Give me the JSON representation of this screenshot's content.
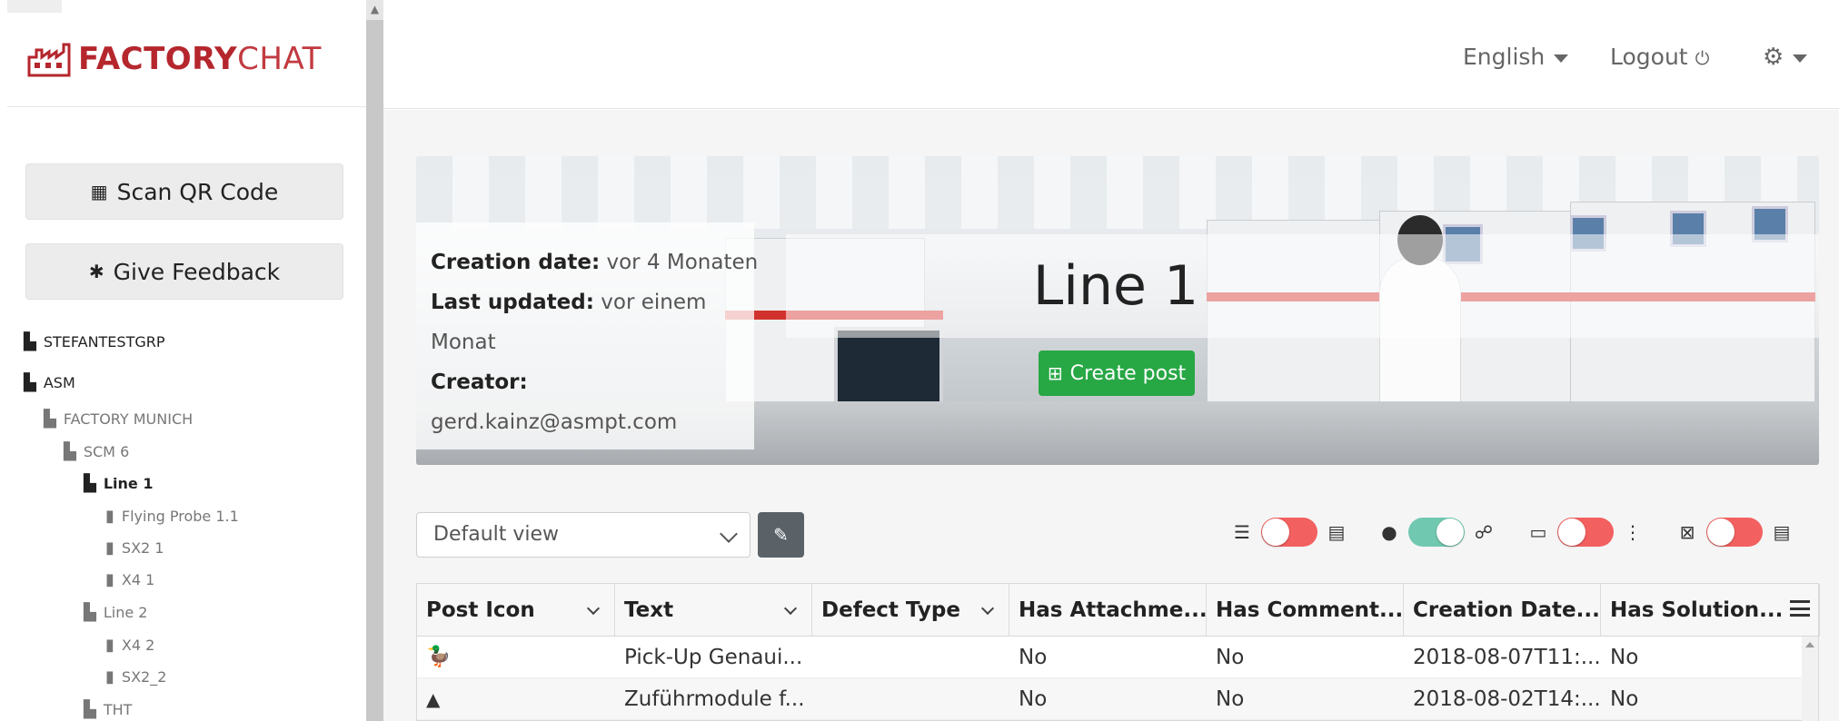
{
  "app": {
    "brand_bold": "FACTORY",
    "brand_light": "CHAT",
    "brand_color": "#b5262d"
  },
  "sidebar": {
    "buttons": [
      {
        "icon": "qr-code-icon",
        "glyph": "▦",
        "label": "Scan QR Code"
      },
      {
        "icon": "bug-icon",
        "glyph": "✱",
        "label": "Give Feedback"
      }
    ],
    "tree": [
      {
        "label": "STEFANTESTGRP",
        "icon": "factory-icon"
      },
      {
        "label": "ASM",
        "icon": "factory-icon"
      },
      {
        "label": "FACTORY MUNICH",
        "icon": "factory-icon"
      },
      {
        "label": "SCM 6",
        "icon": "factory-icon"
      },
      {
        "label": "Line 1",
        "icon": "factory-icon"
      },
      {
        "label": "Flying Probe 1.1",
        "icon": "machine-icon"
      },
      {
        "label": "SX2 1",
        "icon": "machine-icon"
      },
      {
        "label": "X4 1",
        "icon": "machine-icon"
      },
      {
        "label": "Line 2",
        "icon": "factory-icon"
      },
      {
        "label": "X4 2",
        "icon": "machine-icon"
      },
      {
        "label": "SX2_2",
        "icon": "machine-icon"
      },
      {
        "label": "THT",
        "icon": "factory-icon"
      }
    ]
  },
  "topbar": {
    "language": "English",
    "logout": "Logout",
    "logout_icon": "⏻",
    "settings_icon": "⚙"
  },
  "banner": {
    "creation_label": "Creation date:",
    "creation_value": "vor 4 Monaten",
    "updated_label": "Last updated:",
    "updated_value_1": "vor einem",
    "updated_value_2": "Monat",
    "creator_label": "Creator:",
    "creator_value": "gerd.kainz@asmpt.com",
    "title": "Line 1",
    "create_post": "Create post",
    "create_color": "#28a745"
  },
  "controls": {
    "view_select": "Default view",
    "toggles": [
      {
        "left_icon": "list-icon",
        "left_glyph": "☰",
        "state": "off",
        "right_icon": "comment-icon",
        "right_glyph": "▤"
      },
      {
        "left_icon": "user-icon",
        "left_glyph": "●",
        "state": "on",
        "right_icon": "users-icon",
        "right_glyph": "☍"
      },
      {
        "left_icon": "folder-icon",
        "left_glyph": "▭",
        "state": "off",
        "right_icon": "tree-icon",
        "right_glyph": "⋮"
      },
      {
        "left_icon": "comment-x-icon",
        "left_glyph": "⊠",
        "state": "off",
        "right_icon": "comments-icon",
        "right_glyph": "▤"
      }
    ],
    "toggle_off_color": "#f2605f",
    "toggle_on_color": "#71c8b0"
  },
  "table": {
    "columns": [
      "Post Icon",
      "Text",
      "Defect Type",
      "Has Attachme...",
      "Has Comment...",
      "Creation Date...",
      "Has Solution..."
    ],
    "rows": [
      {
        "icon": "duck-icon",
        "glyph": "🦆",
        "text": "Pick-Up Genaui...",
        "defect": "",
        "attach": "No",
        "comment": "No",
        "date": "2018-08-07T11:...",
        "solution": "No"
      },
      {
        "icon": "warning-icon",
        "glyph": "▲",
        "text": "Zuführmodule f...",
        "defect": "",
        "attach": "No",
        "comment": "No",
        "date": "2018-08-02T14:...",
        "solution": "No"
      }
    ]
  }
}
